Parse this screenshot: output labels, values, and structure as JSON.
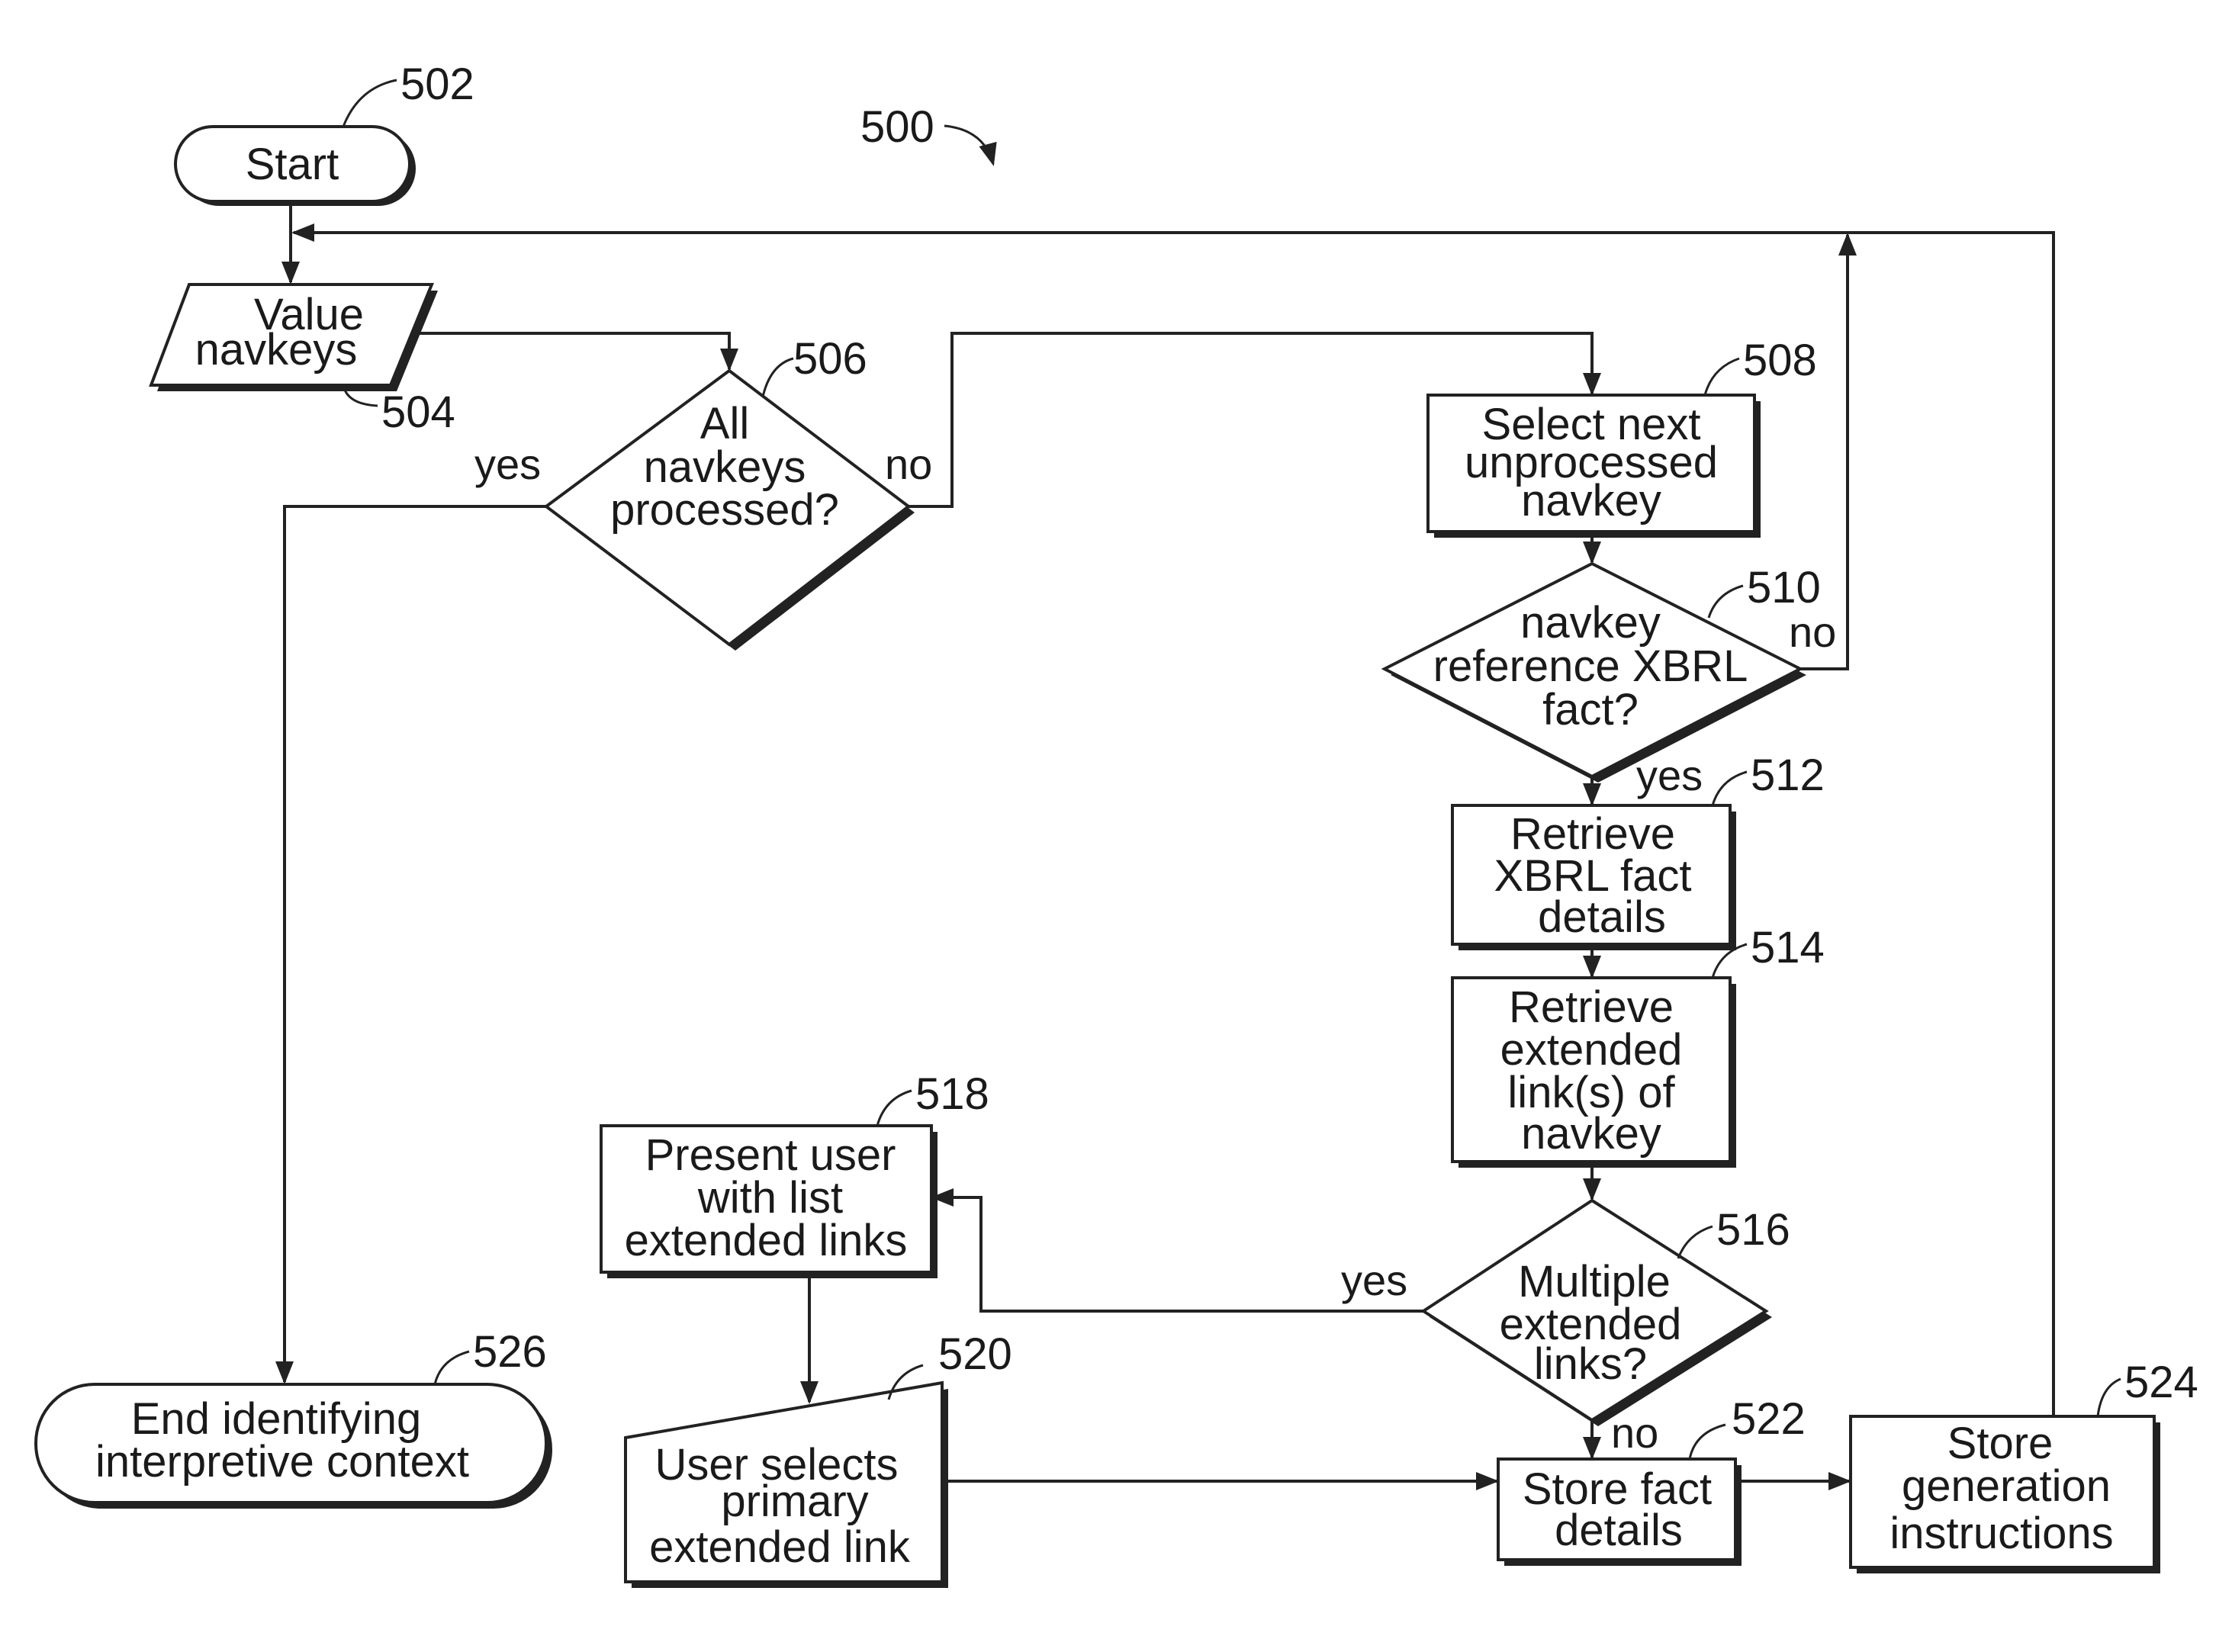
{
  "figure": {
    "ref": "500",
    "nodes": {
      "start": {
        "ref": "502",
        "lines": [
          "Start"
        ]
      },
      "value_navkeys": {
        "ref": "504",
        "lines": [
          "Value",
          "navkeys"
        ]
      },
      "all_processed": {
        "ref": "506",
        "lines": [
          "All",
          "navkeys",
          "processed?"
        ],
        "yes": "yes",
        "no": "no"
      },
      "select_next": {
        "ref": "508",
        "lines": [
          "Select next",
          "unprocessed",
          "navkey"
        ]
      },
      "reference_fact": {
        "ref": "510",
        "lines": [
          "navkey",
          "reference XBRL",
          "fact?"
        ],
        "yes": "yes",
        "no": "no"
      },
      "retrieve_fact": {
        "ref": "512",
        "lines": [
          "Retrieve",
          "XBRL fact",
          "details"
        ]
      },
      "retrieve_links": {
        "ref": "514",
        "lines": [
          "Retrieve",
          "extended",
          "link(s) of",
          "navkey"
        ]
      },
      "multiple_links": {
        "ref": "516",
        "lines": [
          "Multiple",
          "extended",
          "links?"
        ],
        "yes": "yes",
        "no": "no"
      },
      "present_user": {
        "ref": "518",
        "lines": [
          "Present user",
          "with list",
          "extended links"
        ]
      },
      "user_selects": {
        "ref": "520",
        "lines": [
          "User selects",
          "primary",
          "extended link"
        ]
      },
      "store_fact": {
        "ref": "522",
        "lines": [
          "Store fact",
          "details"
        ]
      },
      "store_instructions": {
        "ref": "524",
        "lines": [
          "Store",
          "generation",
          "instructions"
        ]
      },
      "end": {
        "ref": "526",
        "lines": [
          "End identifying",
          "interpretive context"
        ]
      }
    }
  }
}
